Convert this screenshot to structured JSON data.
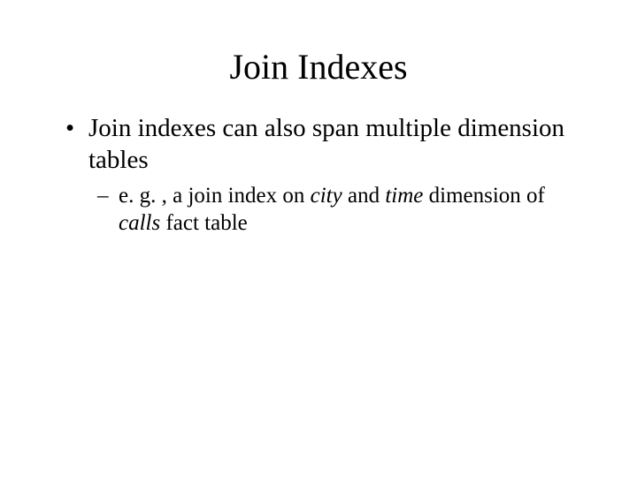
{
  "title": "Join Indexes",
  "bullet1": "Join indexes can also span multiple dimension tables",
  "sub1_pre": "e. g. , a join index on ",
  "sub1_city": "city",
  "sub1_mid1": " and ",
  "sub1_time": "time",
  "sub1_mid2": " dimension of ",
  "sub1_calls": "calls",
  "sub1_post": " fact table"
}
